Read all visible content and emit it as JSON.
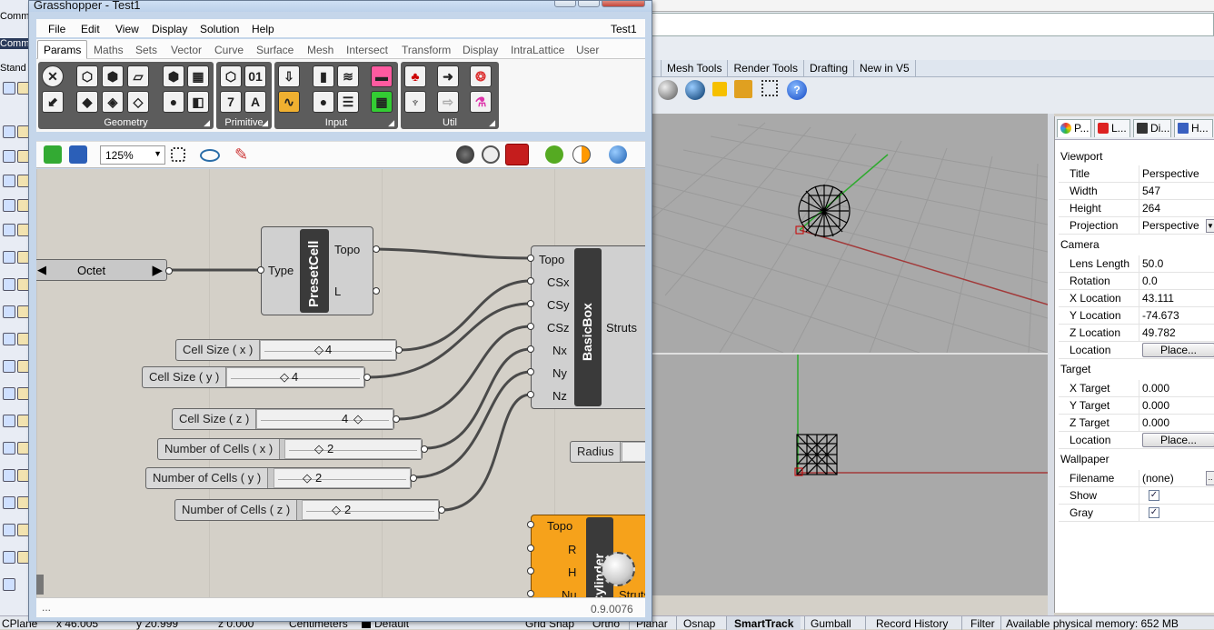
{
  "rhino": {
    "top_fragments": [
      "Comm",
      "Comm",
      "Stand"
    ],
    "tabs": [
      "Mesh Tools",
      "Render Tools",
      "Drafting",
      "New in V5"
    ],
    "status": {
      "cplane": "CPlane",
      "x": "x 46.005",
      "y": "y 20.999",
      "z": "z 0.000",
      "units": "Centimeters",
      "layer": "Default",
      "grid_snap": "Grid Snap",
      "ortho": "Ortho",
      "planar": "Planar",
      "osnap": "Osnap",
      "smarttrack": "SmartTrack",
      "gumball": "Gumball",
      "record_history": "Record History",
      "filter": "Filter",
      "memory": "Available physical memory: 652 MB"
    }
  },
  "properties": {
    "tabs": [
      "P...",
      "L...",
      "Di...",
      "H..."
    ],
    "viewport_header": "Viewport",
    "title_label": "Title",
    "title_value": "Perspective",
    "width_label": "Width",
    "width_value": "547",
    "height_label": "Height",
    "height_value": "264",
    "projection_label": "Projection",
    "projection_value": "Perspective",
    "camera_header": "Camera",
    "lens_label": "Lens Length",
    "lens_value": "50.0",
    "rotation_label": "Rotation",
    "rotation_value": "0.0",
    "xloc_label": "X Location",
    "xloc_value": "43.111",
    "yloc_label": "Y Location",
    "yloc_value": "-74.673",
    "zloc_label": "Z Location",
    "zloc_value": "49.782",
    "location_label": "Location",
    "place_button": "Place...",
    "target_header": "Target",
    "xt_label": "X Target",
    "xt_value": "0.000",
    "yt_label": "Y Target",
    "yt_value": "0.000",
    "zt_label": "Z Target",
    "zt_value": "0.000",
    "tlocation_label": "Location",
    "tplace_button": "Place...",
    "wallpaper_header": "Wallpaper",
    "filename_label": "Filename",
    "filename_value": "(none)",
    "show_label": "Show",
    "gray_label": "Gray",
    "show_checked": true,
    "gray_checked": true
  },
  "gh": {
    "title": "Grasshopper - Test1",
    "doc_name": "Test1",
    "menu": [
      "File",
      "Edit",
      "View",
      "Display",
      "Solution",
      "Help"
    ],
    "tabs": [
      "Params",
      "Maths",
      "Sets",
      "Vector",
      "Curve",
      "Surface",
      "Mesh",
      "Intersect",
      "Transform",
      "Display",
      "IntraLattice",
      "User"
    ],
    "groups": [
      "Geometry",
      "Primitive",
      "Input",
      "Util"
    ],
    "zoom": "125%",
    "version": "0.9.0076",
    "footer_left": "...",
    "value_list": "Octet",
    "presetcell": {
      "name": "PresetCell",
      "input": "Type",
      "out1": "Topo",
      "out2": "L"
    },
    "basicbox": {
      "name": "BasicBox",
      "inputs": [
        "Topo",
        "CSx",
        "CSy",
        "CSz",
        "Nx",
        "Ny",
        "Nz"
      ],
      "output": "Struts"
    },
    "sliders": [
      {
        "label": "Cell Size ( x )",
        "value": "4"
      },
      {
        "label": "Cell Size ( y )",
        "value": "4"
      },
      {
        "label": "Cell Size ( z )",
        "value": "4"
      },
      {
        "label": "Number of Cells ( x )",
        "value": "2"
      },
      {
        "label": "Number of Cells ( y )",
        "value": "2"
      },
      {
        "label": "Number of Cells ( z )",
        "value": "2"
      }
    ],
    "radius_label": "Radius",
    "cylinder": {
      "name": "Cylinder",
      "inputs": [
        "Topo",
        "R",
        "H",
        "Nu"
      ],
      "output": "Struts"
    }
  }
}
